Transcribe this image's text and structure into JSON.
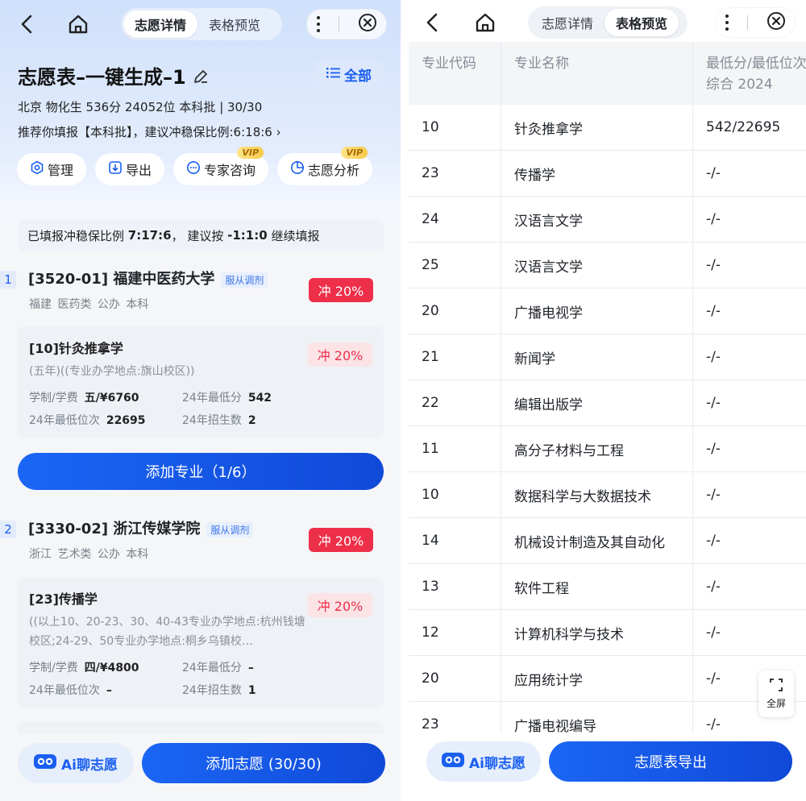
{
  "left": {
    "tabs": [
      "志愿详情",
      "表格预览"
    ],
    "title": "志愿表–一键生成–1",
    "all_button": "全部",
    "info_line1": "北京 物化生 536分 24052位 本科批 | 30/30",
    "info_line2": "推荐你填报【本科批】，建议冲稳保比例:6:18:6",
    "actions": [
      {
        "label": "管理",
        "icon": "settings-icon",
        "vip": ""
      },
      {
        "label": "导出",
        "icon": "export-icon",
        "vip": ""
      },
      {
        "label": "专家咨询",
        "icon": "chat-icon",
        "vip": "VIP"
      },
      {
        "label": "志愿分析",
        "icon": "pie-chart-icon",
        "vip": "VIP"
      }
    ],
    "summary_prefix": "已填报冲稳保比例",
    "summary_ratio": "7:17:6",
    "summary_mid": "， 建议按",
    "summary_suggest": "-1:1:0",
    "summary_suffix": "继续填报",
    "universities": [
      {
        "index": "1",
        "name": "[3520-01] 福建中医药大学",
        "tag": "服从调剂",
        "meta": "福建 医药类 公办 本科",
        "rush": "冲 20%",
        "major": {
          "name": "[10]针灸推拿学",
          "desc": "(五年)((专业办学地点:旗山校区))",
          "rush": "冲 20%",
          "fields": [
            {
              "label": "学制/学费",
              "value": "五/¥6760"
            },
            {
              "label": "24年最低分",
              "value": "542"
            },
            {
              "label": "24年最低位次",
              "value": "22695"
            },
            {
              "label": "24年招生数",
              "value": "2"
            }
          ]
        }
      },
      {
        "index": "2",
        "name": "[3330-02] 浙江传媒学院",
        "tag": "服从调剂",
        "meta": "浙江 艺术类 公办 本科",
        "rush": "冲 20%",
        "major": {
          "name": "[23]传播学",
          "desc": "((以上10、20-23、30、40-43专业办学地点:杭州钱塘校区;24-29、50专业办学地点:桐乡乌镇校…",
          "rush": "冲 20%",
          "fields": [
            {
              "label": "学制/学费",
              "value": "四/¥4800"
            },
            {
              "label": "24年最低分",
              "value": "–"
            },
            {
              "label": "24年最低位次",
              "value": "–"
            },
            {
              "label": "24年招生数",
              "value": "1"
            }
          ]
        }
      }
    ],
    "add_major_button": "添加专业（1/6）",
    "ai_button": "Ai聊志愿",
    "add_choice_button": "添加志愿 (30/30)"
  },
  "right": {
    "tabs": [
      "志愿详情",
      "表格预览"
    ],
    "columns": [
      "专业代码",
      "专业名称",
      "最低分/最低位次",
      "综合 2024"
    ],
    "rows": [
      [
        "10",
        "针灸推拿学",
        "542/22695"
      ],
      [
        "23",
        "传播学",
        "-/-"
      ],
      [
        "24",
        "汉语言文学",
        "-/-"
      ],
      [
        "25",
        "汉语言文学",
        "-/-"
      ],
      [
        "20",
        "广播电视学",
        "-/-"
      ],
      [
        "21",
        "新闻学",
        "-/-"
      ],
      [
        "22",
        "编辑出版学",
        "-/-"
      ],
      [
        "11",
        "高分子材料与工程",
        "-/-"
      ],
      [
        "10",
        "数据科学与大数据技术",
        "-/-"
      ],
      [
        "14",
        "机械设计制造及其自动化",
        "-/-"
      ],
      [
        "13",
        "软件工程",
        "-/-"
      ],
      [
        "12",
        "计算机科学与技术",
        "-/-"
      ],
      [
        "20",
        "应用统计学",
        "-/-"
      ],
      [
        "23",
        "广播电视编导",
        "-/-"
      ]
    ],
    "fullscreen_label": "全屏",
    "ai_button": "Ai聊志愿",
    "export_button": "志愿表导出"
  },
  "colors": {
    "accent": "#1a5ff0",
    "rush": "#ee2f4a",
    "vip": "#f8c94a"
  }
}
